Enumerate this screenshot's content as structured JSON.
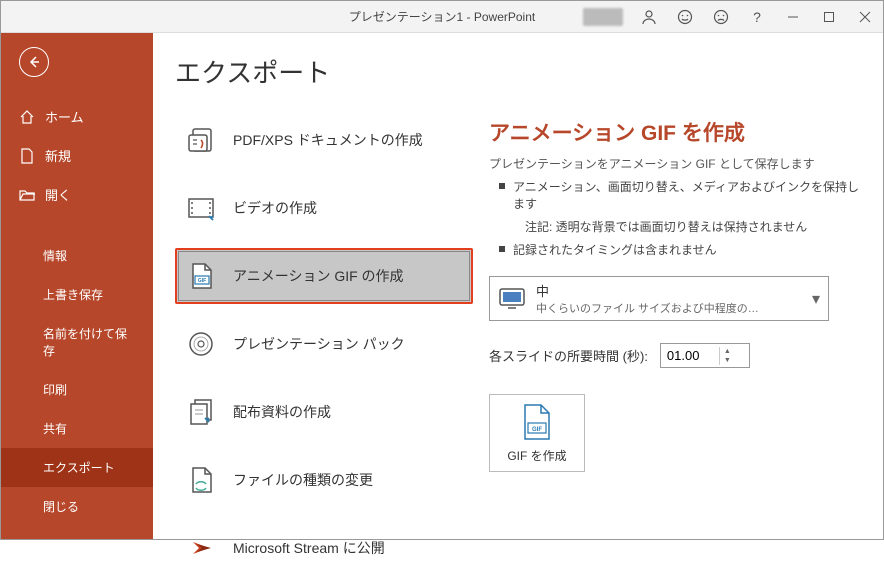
{
  "titlebar": {
    "title": "プレゼンテーション1 - PowerPoint"
  },
  "sidebar": {
    "home": "ホーム",
    "new": "新規",
    "open": "開く",
    "info": "情報",
    "save": "上書き保存",
    "saveas": "名前を付けて保存",
    "print": "印刷",
    "share": "共有",
    "export": "エクスポート",
    "close": "閉じる"
  },
  "page": {
    "title": "エクスポート"
  },
  "export_items": {
    "pdf": "PDF/XPS ドキュメントの作成",
    "video": "ビデオの作成",
    "gif": "アニメーション GIF の作成",
    "package": "プレゼンテーション パック",
    "handout": "配布資料の作成",
    "filetype": "ファイルの種類の変更",
    "stream": "Microsoft Stream に公開"
  },
  "detail": {
    "title": "アニメーション GIF を作成",
    "subtitle": "プレゼンテーションをアニメーション GIF として保存します",
    "b1": "アニメーション、画面切り替え、メディアおよびインクを保持します",
    "note": "注記: 透明な背景では画面切り替えは保持されません",
    "b2": "記録されたタイミングは含まれません",
    "dd_main": "中",
    "dd_sub": "中くらいのファイル サイズおよび中程度の…",
    "time_label": "各スライドの所要時間 (秒):",
    "time_value": "01.00",
    "create": "GIF を作成"
  }
}
